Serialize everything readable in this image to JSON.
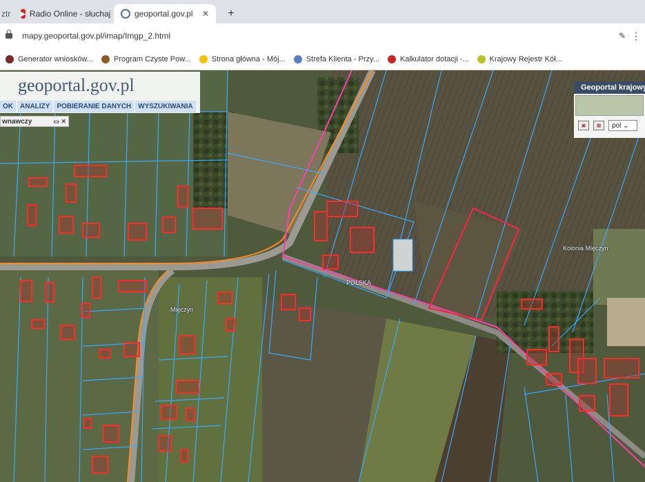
{
  "browser": {
    "tabs": [
      {
        "label": "ztr",
        "active": false
      },
      {
        "label": "Radio Online - słuchaj",
        "active": false
      },
      {
        "label": "geoportal.gov.pl",
        "active": true
      }
    ],
    "new_tab_symbol": "+",
    "url": "mapy.geoportal.gov.pl/imap/Imgp_2.html",
    "bookmarks": [
      {
        "label": "Generator wniosków...",
        "icon_color": "#7a2a2a"
      },
      {
        "label": "Program Czyste Pow...",
        "icon_color": "#8b5a2b"
      },
      {
        "label": "Strona główna - Mój...",
        "icon_color": "#f2c200"
      },
      {
        "label": "Strefa Klienta - Przy...",
        "icon_color": "#5b7fbf"
      },
      {
        "label": "Kalkulator dotacji -...",
        "icon_color": "#c62828"
      },
      {
        "label": "Krajowy Rejestr Kół...",
        "icon_color": "#b6c52a"
      }
    ]
  },
  "geoportal": {
    "logo_prefix": "geo",
    "logo_rest": "portal.gov.pl",
    "menu": [
      "OK",
      "ANALIZY",
      "POBIERANIE DANYCH",
      "WYSZUKIWANIA"
    ],
    "panel_title": "wnawczy",
    "panel_controls": "▭ ✕",
    "right_panel_title": "Geoportal krajowy",
    "language": "pol",
    "map_labels": {
      "village": "Mięczyn",
      "settlement": "Kolonia Mięczyn",
      "country": "POLSKA"
    }
  },
  "colors": {
    "parcel_line": "#3aa8ff",
    "building": "#ff2a2a",
    "highlight_parcel": "#ff2244",
    "road_orange": "#ff8a1e",
    "border_pink": "#ff3fa8"
  }
}
